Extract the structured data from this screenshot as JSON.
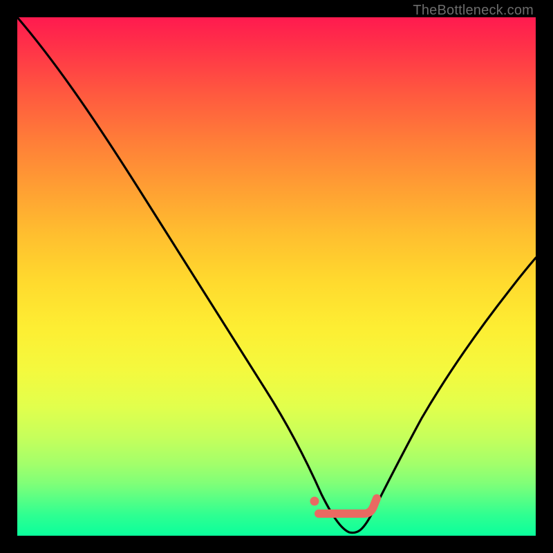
{
  "watermark": "TheBottleneck.com",
  "colors": {
    "page_bg": "#000000",
    "curve": "#000000",
    "marker": "#e96a62",
    "gradient_top": "#ff1a4f",
    "gradient_bottom": "#0aff9c"
  },
  "chart_data": {
    "type": "line",
    "title": "",
    "xlabel": "",
    "ylabel": "",
    "xlim": [
      0,
      100
    ],
    "ylim": [
      0,
      100
    ],
    "series": [
      {
        "name": "bottleneck-curve",
        "x": [
          0,
          5,
          10,
          15,
          20,
          25,
          30,
          35,
          40,
          45,
          50,
          55,
          57,
          60,
          63,
          66,
          70,
          75,
          80,
          85,
          90,
          95,
          100
        ],
        "y": [
          100,
          93,
          86,
          78,
          70,
          62,
          54,
          46,
          38,
          29,
          20,
          11,
          6,
          2,
          0.5,
          0.5,
          2,
          8,
          16,
          25,
          34,
          43,
          53
        ]
      }
    ],
    "annotations": [
      {
        "name": "optimal-marker",
        "type": "marker-segment",
        "x_start": 57,
        "x_end": 68,
        "y": 4,
        "dot_x": 57,
        "dot_y": 6
      }
    ]
  }
}
